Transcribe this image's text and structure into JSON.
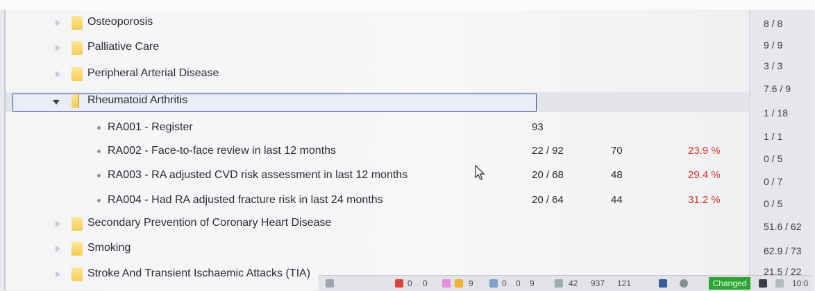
{
  "tree": {
    "rows": [
      {
        "label": "Osteoporosis",
        "expanded": false
      },
      {
        "label": "Palliative Care",
        "expanded": false
      },
      {
        "label": "Peripheral Arterial Disease",
        "expanded": false
      },
      {
        "label": "Rheumatoid Arthritis",
        "expanded": true,
        "selected": true
      },
      {
        "label": "Secondary Prevention of Coronary Heart Disease",
        "expanded": false
      },
      {
        "label": "Smoking",
        "expanded": false
      },
      {
        "label": "Stroke And Transient Ischaemic Attacks (TIA)",
        "expanded": false
      }
    ],
    "indicators": [
      {
        "label": "RA001 - Register",
        "c1": "93",
        "c2": "",
        "c3": ""
      },
      {
        "label": "RA002 - Face-to-face review in last 12 months",
        "c1": "22 / 92",
        "c2": "70",
        "c3": "23.9 %"
      },
      {
        "label": "RA003 - RA adjusted CVD risk assessment in last 12 months",
        "c1": "20 / 68",
        "c2": "48",
        "c3": "29.4 %"
      },
      {
        "label": "RA004 - Had RA adjusted fracture risk in last 24 months",
        "c1": "20 / 64",
        "c2": "44",
        "c3": "31.2 %"
      }
    ]
  },
  "scores": [
    "8 / 8",
    "9 / 9",
    "3 / 3",
    "7.6 / 9",
    "1 / 18",
    "1 / 1",
    "0 / 5",
    "0 / 7",
    "0 / 5",
    "51.6 / 62",
    "62.9 / 73",
    "21.5 / 22"
  ],
  "taskbar": {
    "n1": "0",
    "n2": "0",
    "n3": "9",
    "n4": "0",
    "n5": "0",
    "n6": "9",
    "n7": "42",
    "n8": "937",
    "n9": "121",
    "status": "Changed",
    "time": "10:0"
  },
  "colors": {
    "selection_border": "#3d4d8f",
    "percent_text": "#d6342e",
    "changed_badge": "#2fa436"
  }
}
